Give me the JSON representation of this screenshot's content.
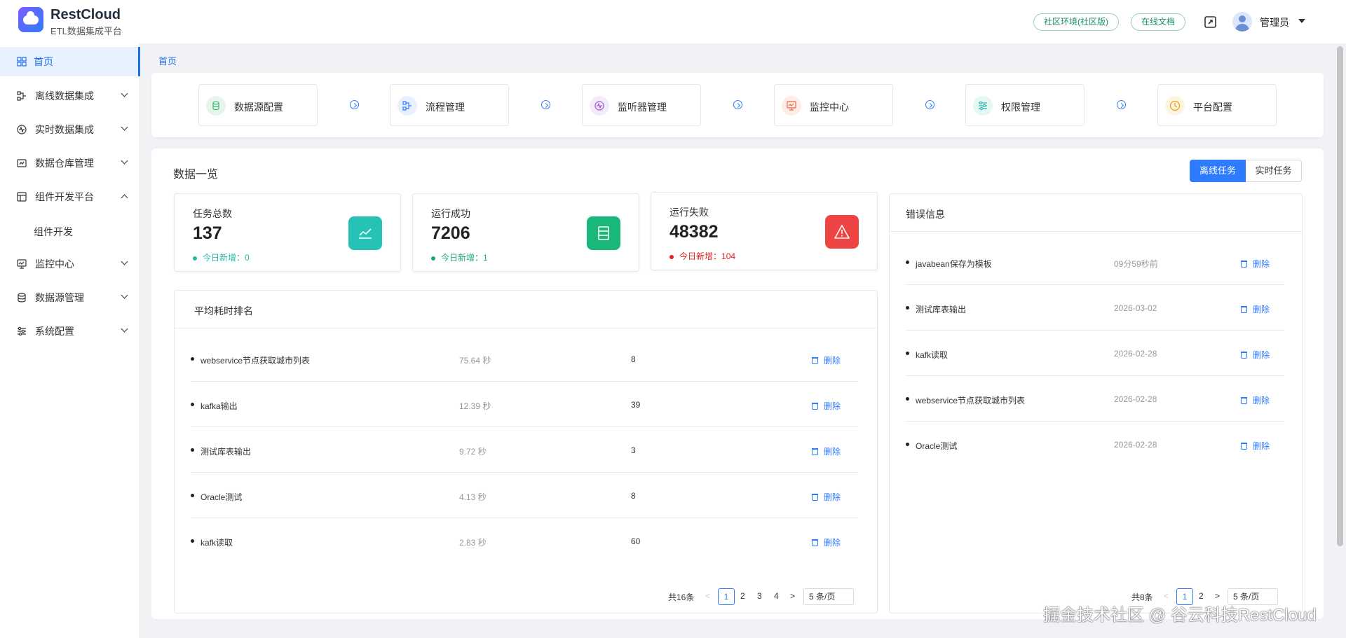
{
  "header": {
    "brand_name": "RestCloud",
    "brand_sub": "ETL数据集成平台",
    "env_button": "社区环境(社区版)",
    "docs_button": "在线文档",
    "user_name": "管理员"
  },
  "sidebar": {
    "items": [
      {
        "label": "首页",
        "icon": "home-grid-icon",
        "active": true
      },
      {
        "label": "离线数据集成",
        "icon": "offline-integration-icon"
      },
      {
        "label": "实时数据集成",
        "icon": "realtime-integration-icon"
      },
      {
        "label": "数据仓库管理",
        "icon": "warehouse-icon"
      },
      {
        "label": "组件开发平台",
        "icon": "component-platform-icon",
        "expanded": true
      },
      {
        "label": "组件开发",
        "sub": true
      },
      {
        "label": "监控中心",
        "icon": "monitor-icon"
      },
      {
        "label": "数据源管理",
        "icon": "database-icon"
      },
      {
        "label": "系统配置",
        "icon": "settings-sliders-icon"
      }
    ]
  },
  "breadcrumb": "首页",
  "quicknav": [
    {
      "label": "数据源配置",
      "icon": "database-icon",
      "color": "#3cb878"
    },
    {
      "label": "流程管理",
      "icon": "flow-icon",
      "color": "#2f7bff"
    },
    {
      "label": "监听器管理",
      "icon": "listener-icon",
      "color": "#9b59d0"
    },
    {
      "label": "监控中心",
      "icon": "monitor-icon",
      "color": "#e96a4a"
    },
    {
      "label": "权限管理",
      "icon": "permission-icon",
      "color": "#2cb6a8"
    },
    {
      "label": "平台配置",
      "icon": "clock-icon",
      "color": "#e8a317"
    }
  ],
  "overview": {
    "title": "数据一览",
    "tab_offline": "离线任务",
    "tab_realtime": "实时任务",
    "stats": [
      {
        "label": "任务总数",
        "value": "137",
        "new_label": "今日新增：",
        "new_value": "0",
        "color": "#26c2b6",
        "new_color": "#26b8a8"
      },
      {
        "label": "运行成功",
        "value": "7206",
        "new_label": "今日新增：",
        "new_value": "1",
        "color": "#19b77a",
        "new_color": "#19a96c"
      },
      {
        "label": "运行失败",
        "value": "48382",
        "new_label": "今日新增：",
        "new_value": "104",
        "color": "#ef4444",
        "new_color": "#e02424"
      }
    ]
  },
  "ranking": {
    "title": "平均耗时排名",
    "delete_label": "删除",
    "rows": [
      {
        "name": "webservice节点获取城市列表",
        "time": "75.64 秒",
        "count": "8"
      },
      {
        "name": "kafka输出",
        "time": "12.39 秒",
        "count": "39"
      },
      {
        "name": "测试库表输出",
        "time": "9.72 秒",
        "count": "3"
      },
      {
        "name": "Oracle测试",
        "time": "4.13 秒",
        "count": "8"
      },
      {
        "name": "kafk读取",
        "time": "2.83 秒",
        "count": "60"
      }
    ],
    "pager": {
      "total": "共16条",
      "pages": [
        "1",
        "2",
        "3",
        "4"
      ],
      "current": "1",
      "size": "5 条/页"
    }
  },
  "errors": {
    "title": "错误信息",
    "delete_label": "删除",
    "rows": [
      {
        "name": "javabean保存为模板",
        "time": "09分59秒前"
      },
      {
        "name": "测试库表输出",
        "time": "2026-03-02"
      },
      {
        "name": "kafk读取",
        "time": "2026-02-28"
      },
      {
        "name": "webservice节点获取城市列表",
        "time": "2026-02-28"
      },
      {
        "name": "Oracle测试",
        "time": "2026-02-28"
      }
    ],
    "pager": {
      "total": "共8条",
      "pages": [
        "1",
        "2"
      ],
      "current": "1",
      "size": "5 条/页"
    }
  },
  "watermark": "掘金技术社区 @ 谷云科技RestCloud"
}
